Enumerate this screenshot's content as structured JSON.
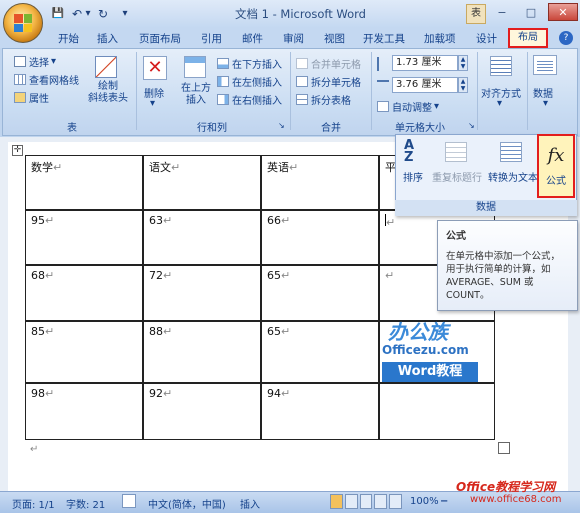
{
  "window": {
    "title": "文档 1 - Microsoft Word",
    "context_tab_label": "表",
    "min_glyph": "−",
    "max_glyph": "□",
    "close_glyph": "✕"
  },
  "quick_access": {
    "save": "💾",
    "undo": "↶",
    "undo_dd": "▾",
    "redo": "↻",
    "customize": "▾"
  },
  "tabs": [
    "开始",
    "插入",
    "页面布局",
    "引用",
    "邮件",
    "审阅",
    "视图",
    "开发工具",
    "加载项",
    "设计",
    "布局"
  ],
  "help_glyph": "?",
  "ribbon": {
    "table": {
      "select": "选择",
      "select_dd": "▾",
      "gridlines": "查看网格线",
      "props": "属性",
      "draw_diag": "绘制\n斜线表头",
      "label": "表"
    },
    "rows_cols": {
      "delete": "删除",
      "delete_dd": "▾",
      "insert_above": "在上方\n插入",
      "insert_below": "在下方插入",
      "insert_left": "在左侧插入",
      "insert_right": "在右侧插入",
      "label": "行和列"
    },
    "merge": {
      "merge_cells": "合并单元格",
      "split_cells": "拆分单元格",
      "split_table": "拆分表格",
      "label": "合并"
    },
    "cell_size": {
      "height": "1.73 厘米",
      "width": "3.76 厘米",
      "autofit": "自动调整",
      "autofit_dd": "▾",
      "label": "单元格大小"
    },
    "alignment": {
      "label": "对齐方式",
      "dd": "▾"
    },
    "data": {
      "label": "数据",
      "dd": "▾"
    },
    "launcher": "↘"
  },
  "dropdown": {
    "sort": "排序",
    "repeat_header": "重复标题行",
    "convert_text": "转换为文本",
    "formula": "公式",
    "group_label": "数据",
    "fx_glyph": "fx"
  },
  "tooltip": {
    "title": "公式",
    "body": "在单元格中添加一个公式，用于执行简单的计算，如 AVERAGE、SUM 或 COUNT。"
  },
  "table": {
    "headers": [
      "数学",
      "语文",
      "英语",
      "平"
    ],
    "rows": [
      [
        "95",
        "63",
        "66",
        ""
      ],
      [
        "68",
        "72",
        "65",
        ""
      ],
      [
        "85",
        "88",
        "65",
        ""
      ],
      [
        "98",
        "92",
        "94",
        ""
      ]
    ],
    "cell_mark": "↵",
    "move_handle": "✛"
  },
  "watermark": {
    "line1": "办公族",
    "line2": "Officezu.com",
    "line3": "Word教程"
  },
  "status": {
    "page": "页面: 1/1",
    "words": "字数: 21",
    "lang": "中文(简体，中国)",
    "mode": "插入",
    "zoom": "100%",
    "zoom_minus": "−",
    "zoom_plus": "+"
  },
  "site_watermark": {
    "line1": "Office教程学习网",
    "line2": "www.office68.com"
  }
}
